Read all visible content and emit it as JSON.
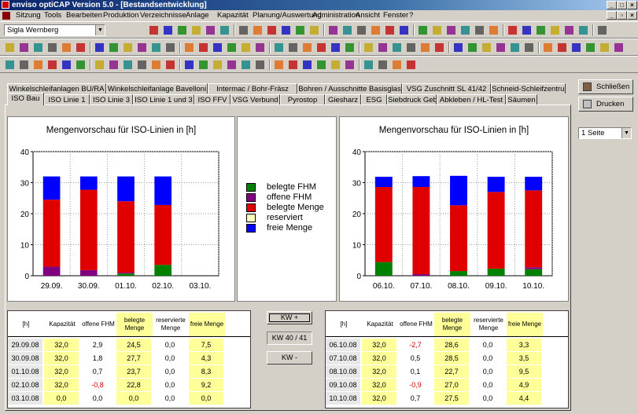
{
  "window": {
    "title": "enviso optiCAP Version 5.0 - [Bestandsentwicklung]"
  },
  "menu": [
    {
      "label": "Sitzung"
    },
    {
      "label": "Tools"
    },
    {
      "label": "Bearbeiten"
    },
    {
      "label": "Produktion"
    },
    {
      "label": "Verzeichnisse"
    },
    {
      "label": "Anlage"
    },
    {
      "label": "Kapazität"
    },
    {
      "label": "Planung/Auswertung"
    },
    {
      "label": "Administration"
    },
    {
      "label": "Ansicht"
    },
    {
      "label": "Fenster"
    },
    {
      "label": "?"
    }
  ],
  "toolbar": {
    "combo_value": "Sigla Wernberg"
  },
  "tabs_row1": [
    "Winkelschleifanlagen BU/RA",
    "Winkelschleifanlage Bavelloni",
    "Intermac / Bohr-Fräsz",
    "Bohren / Ausschnitte Basisglas",
    "VSG Zuschnitt SL 41/42",
    "Schneid-Schleifzentrum"
  ],
  "tabs_row2": [
    "ISO Bau",
    "ISO Linie 1",
    "ISO Linie 3",
    "ISO Linie 1 und 3",
    "ISO FFV",
    "VSG Verbund",
    "Pyrostop",
    "Giesharz",
    "ESG",
    "Siebdruck Geb.5",
    "Abkleben / HL-Test",
    "Säumen"
  ],
  "side": {
    "close_label": "Schließen",
    "print_label": "Drucken",
    "pages_value": "1 Seite"
  },
  "legend": [
    {
      "label": "belegte FHM",
      "color": "#008000"
    },
    {
      "label": "offene FHM",
      "color": "#800080"
    },
    {
      "label": "belegte Menge",
      "color": "#e00000"
    },
    {
      "label": "reserviert",
      "color": "#ffffc0"
    },
    {
      "label": "freie Menge",
      "color": "#0000ff"
    }
  ],
  "chart_data": [
    {
      "type": "bar",
      "title": "Mengenvorschau für ISO-Linien in [h]",
      "categories": [
        "29.09.",
        "30.09.",
        "01.10.",
        "02.10.",
        "03.10."
      ],
      "ylim": [
        0,
        40
      ],
      "yticks": [
        0,
        10,
        20,
        30,
        40
      ],
      "stacked": true,
      "series": [
        {
          "name": "belegte FHM",
          "values": [
            0,
            0,
            0.7,
            3.5,
            0
          ]
        },
        {
          "name": "offene FHM",
          "values": [
            2.9,
            1.8,
            0.3,
            0,
            0
          ]
        },
        {
          "name": "belegte Menge",
          "values": [
            21.6,
            25.9,
            23.0,
            19.3,
            0
          ]
        },
        {
          "name": "reserviert",
          "values": [
            0,
            0,
            0,
            0,
            0
          ]
        },
        {
          "name": "freie Menge",
          "values": [
            7.5,
            4.3,
            8.0,
            9.2,
            0
          ]
        }
      ],
      "grid": true
    },
    {
      "type": "bar",
      "title": "Mengenvorschau für ISO-Linien in [h]",
      "categories": [
        "06.10.",
        "07.10.",
        "08.10.",
        "09.10.",
        "10.10."
      ],
      "ylim": [
        0,
        40
      ],
      "yticks": [
        0,
        10,
        20,
        30,
        40
      ],
      "stacked": true,
      "series": [
        {
          "name": "belegte FHM",
          "values": [
            4.4,
            0,
            1.5,
            2.3,
            2.1
          ]
        },
        {
          "name": "offene FHM",
          "values": [
            0,
            0.5,
            0,
            0,
            0.6
          ]
        },
        {
          "name": "belegte Menge",
          "values": [
            24.2,
            28.1,
            21.2,
            24.7,
            24.8
          ]
        },
        {
          "name": "reserviert",
          "values": [
            0,
            0,
            0,
            0,
            0
          ]
        },
        {
          "name": "freie Menge",
          "values": [
            3.3,
            3.5,
            9.5,
            4.9,
            4.4
          ]
        }
      ],
      "grid": true
    }
  ],
  "table_headers": [
    "[h]",
    "Kapazität",
    "offene FHM",
    "belegte Menge",
    "reservierte Menge",
    "freie Menge"
  ],
  "table_left": [
    [
      "29.09.08",
      "32,0",
      "2,9",
      "24,5",
      "0,0",
      "7,5"
    ],
    [
      "30.09.08",
      "32,0",
      "1,8",
      "27,7",
      "0,0",
      "4,3"
    ],
    [
      "01.10.08",
      "32,0",
      "0,7",
      "23,7",
      "0,0",
      "8,3"
    ],
    [
      "02.10.08",
      "32,0",
      "-0,8",
      "22,8",
      "0,0",
      "9,2"
    ],
    [
      "03.10.08",
      "0,0",
      "0,0",
      "0,0",
      "0,0",
      "0,0"
    ]
  ],
  "table_right": [
    [
      "06.10.08",
      "32,0",
      "-2,7",
      "28,6",
      "0,0",
      "3,3"
    ],
    [
      "07.10.08",
      "32,0",
      "0,5",
      "28,5",
      "0,0",
      "3,5"
    ],
    [
      "08.10.08",
      "32,0",
      "0,1",
      "22,7",
      "0,0",
      "9,5"
    ],
    [
      "09.10.08",
      "32,0",
      "-0,9",
      "27,0",
      "0,0",
      "4,9"
    ],
    [
      "10.10.08",
      "32,0",
      "0,7",
      "27,5",
      "0,0",
      "4,4"
    ]
  ],
  "kw": {
    "plus": "KW +",
    "current": "KW 40 / 41",
    "minus": "KW -"
  },
  "colors": {
    "highlight": "#ffff99",
    "negative": "#d00000"
  }
}
